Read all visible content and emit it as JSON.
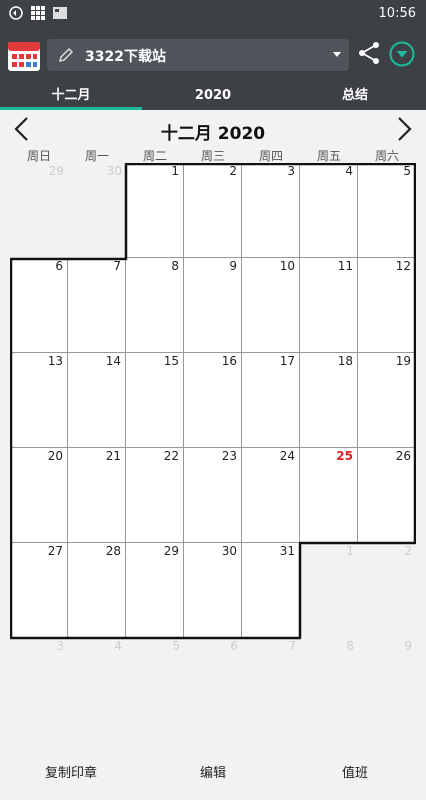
{
  "status_bar": {
    "time": "10:56",
    "icons": [
      "sync-icon",
      "grid-icon",
      "image-icon"
    ]
  },
  "app_bar": {
    "app_icon": "calendar-app-icon",
    "calendar_name": "3322下载站",
    "edit_icon": "pencil-icon",
    "share_icon": "share-icon",
    "download_icon": "download-circle-icon",
    "accent_color": "#1abc9c"
  },
  "tabs": [
    {
      "label": "十二月",
      "selected": true
    },
    {
      "label": "2020",
      "selected": false
    },
    {
      "label": "总结",
      "selected": false
    }
  ],
  "calendar": {
    "title": "十二月 2020",
    "weekdays": [
      "周日",
      "周一",
      "周二",
      "周三",
      "周四",
      "周五",
      "周六"
    ],
    "today": 25,
    "today_color": "#e02020",
    "weeks": [
      [
        {
          "d": "29",
          "in": false
        },
        {
          "d": "30",
          "in": false
        },
        {
          "d": "1",
          "in": true
        },
        {
          "d": "2",
          "in": true
        },
        {
          "d": "3",
          "in": true
        },
        {
          "d": "4",
          "in": true
        },
        {
          "d": "5",
          "in": true
        }
      ],
      [
        {
          "d": "6",
          "in": true
        },
        {
          "d": "7",
          "in": true
        },
        {
          "d": "8",
          "in": true
        },
        {
          "d": "9",
          "in": true
        },
        {
          "d": "10",
          "in": true
        },
        {
          "d": "11",
          "in": true
        },
        {
          "d": "12",
          "in": true
        }
      ],
      [
        {
          "d": "13",
          "in": true
        },
        {
          "d": "14",
          "in": true
        },
        {
          "d": "15",
          "in": true
        },
        {
          "d": "16",
          "in": true
        },
        {
          "d": "17",
          "in": true
        },
        {
          "d": "18",
          "in": true
        },
        {
          "d": "19",
          "in": true
        }
      ],
      [
        {
          "d": "20",
          "in": true
        },
        {
          "d": "21",
          "in": true
        },
        {
          "d": "22",
          "in": true
        },
        {
          "d": "23",
          "in": true
        },
        {
          "d": "24",
          "in": true
        },
        {
          "d": "25",
          "in": true
        },
        {
          "d": "26",
          "in": true
        }
      ],
      [
        {
          "d": "27",
          "in": true
        },
        {
          "d": "28",
          "in": true
        },
        {
          "d": "29",
          "in": true
        },
        {
          "d": "30",
          "in": true
        },
        {
          "d": "31",
          "in": true
        },
        {
          "d": "1",
          "in": false
        },
        {
          "d": "2",
          "in": false
        }
      ],
      [
        {
          "d": "3",
          "in": false
        },
        {
          "d": "4",
          "in": false
        },
        {
          "d": "5",
          "in": false
        },
        {
          "d": "6",
          "in": false
        },
        {
          "d": "7",
          "in": false
        },
        {
          "d": "8",
          "in": false
        },
        {
          "d": "9",
          "in": false
        }
      ]
    ]
  },
  "footer": {
    "copy_stamp": "复制印章",
    "edit": "编辑",
    "on_duty": "值班"
  }
}
